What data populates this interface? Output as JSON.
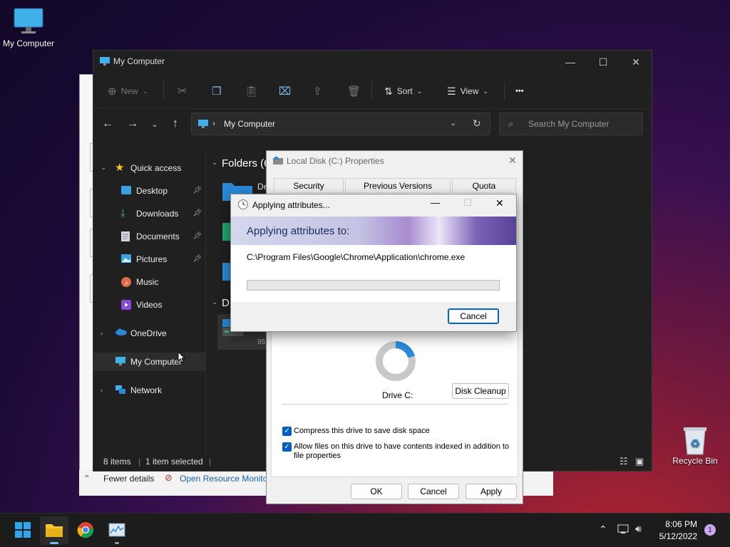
{
  "desktop": {
    "icons": [
      {
        "label": "My Computer"
      },
      {
        "label": "Recycle Bin"
      }
    ]
  },
  "bg_window": {
    "fewer_details": "Fewer details",
    "open_resource_monitor": "Open Resource Monito"
  },
  "explorer": {
    "title": "My Computer",
    "toolbar": {
      "new_label": "New",
      "sort_label": "Sort",
      "view_label": "View",
      "more_label": "•••"
    },
    "address": "My Computer",
    "search_placeholder": "Search My Computer",
    "nav": {
      "quick_access": "Quick access",
      "items": [
        {
          "label": "Desktop"
        },
        {
          "label": "Downloads"
        },
        {
          "label": "Documents"
        },
        {
          "label": "Pictures"
        },
        {
          "label": "Music"
        },
        {
          "label": "Videos"
        }
      ],
      "onedrive": "OneDrive",
      "my_computer": "My Computer",
      "network": "Network"
    },
    "content": {
      "folders_header": "Folders (6",
      "devices_header": "D",
      "folder_stub": "De",
      "drive_stub": "95"
    },
    "status": {
      "items": "8 items",
      "selected": "1 item selected"
    }
  },
  "properties": {
    "title": "Local Disk (C:) Properties",
    "tabs": [
      "Security",
      "Previous Versions",
      "Quota"
    ],
    "drive_label": "Drive C:",
    "disk_cleanup": "Disk Cleanup",
    "compress_label": "Compress this drive to save disk space",
    "index_label": "Allow files on this drive to have contents indexed in addition to file properties",
    "ok": "OK",
    "cancel": "Cancel",
    "apply": "Apply"
  },
  "applying": {
    "title": "Applying attributes...",
    "heading": "Applying attributes to:",
    "path": "C:\\Program Files\\Google\\Chrome\\Application\\chrome.exe",
    "progress": 0,
    "cancel": "Cancel"
  },
  "taskbar": {
    "time": "8:06 PM",
    "date": "5/12/2022",
    "notification_count": "1"
  },
  "colors": {
    "accent": "#0067c0",
    "explorer_bg": "#202020"
  }
}
